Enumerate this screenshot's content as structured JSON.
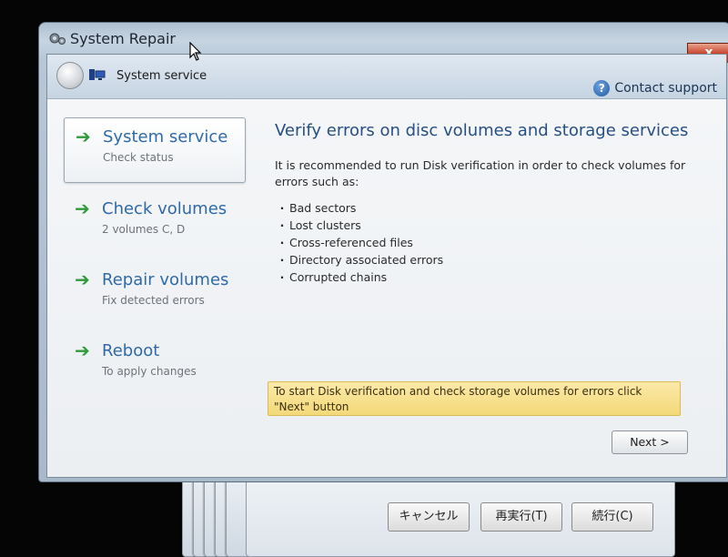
{
  "window": {
    "title": "System Repair",
    "close_label": "x"
  },
  "toolbar": {
    "title": "System service",
    "support_label": "Contact support",
    "help_glyph": "?"
  },
  "steps": [
    {
      "arrow": "➔",
      "title": "System service",
      "subtitle": "Check status"
    },
    {
      "arrow": "➔",
      "title": "Check volumes",
      "subtitle": "2 volumes C, D"
    },
    {
      "arrow": "➔",
      "title": "Repair volumes",
      "subtitle": "Fix detected errors"
    },
    {
      "arrow": "➔",
      "title": "Reboot",
      "subtitle": "To apply changes"
    }
  ],
  "main": {
    "heading": "Verify errors on disc volumes and storage services",
    "intro": "It is recommended to run Disk verification in order to check volumes for errors such as:",
    "bullets": [
      "Bad sectors",
      "Lost clusters",
      "Cross-referenced files",
      "Directory associated errors",
      "Corrupted chains"
    ],
    "notice": "To start Disk verification and check storage volumes for errors click \"Next\" button",
    "next_label": "Next >"
  },
  "background_dialog": {
    "cancel_label": "キャンセル",
    "retry_label": "再実行(T)",
    "continue_label": "続行(C)"
  },
  "colors": {
    "accent_blue": "#2f6aa7",
    "step_arrow_green": "#2f9a3a",
    "notice_yellow": "#f4d979",
    "close_red": "#c8442c"
  },
  "icons": {
    "app": "gear-icon",
    "nav": "computer-icon",
    "help": "help-icon",
    "back": "back-icon",
    "cursor": "mouse-cursor-icon"
  }
}
